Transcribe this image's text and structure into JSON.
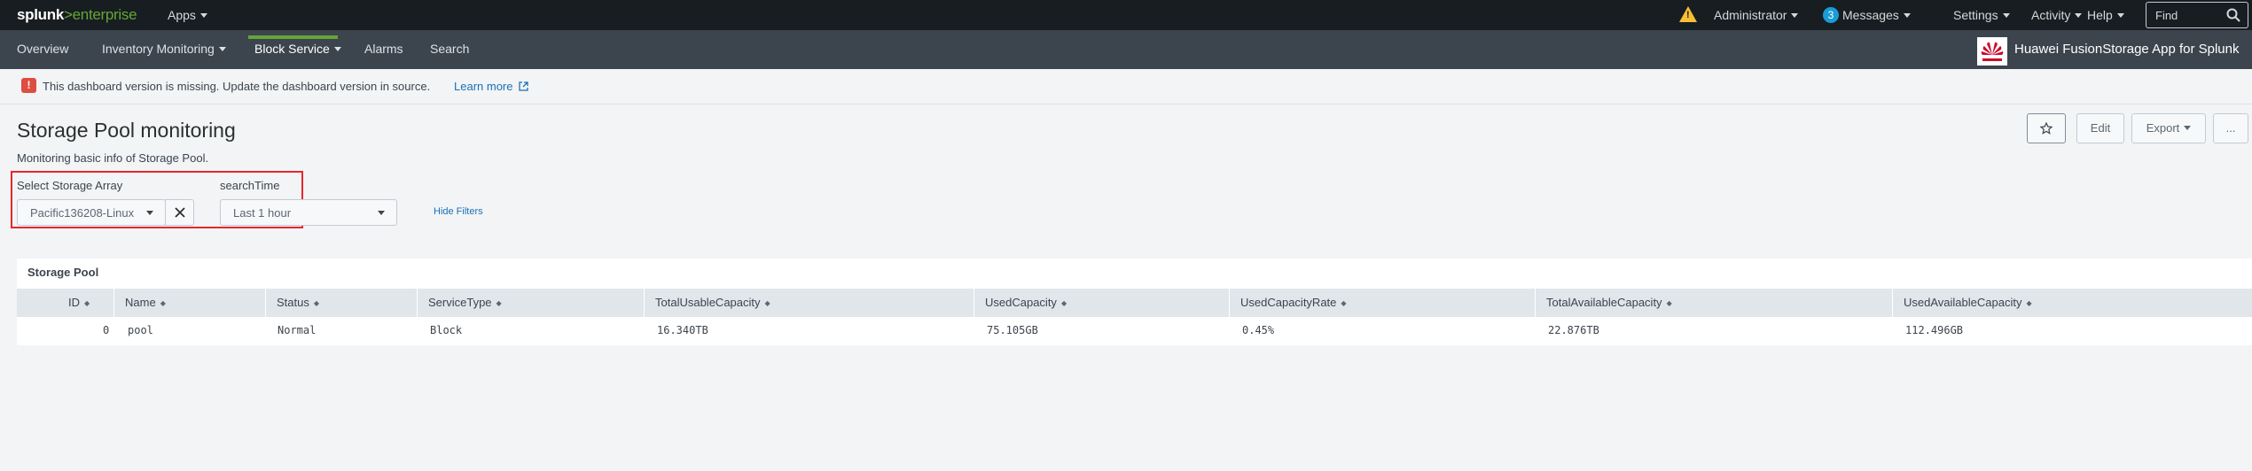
{
  "topbar": {
    "brand_splunk": "splunk",
    "brand_gt": ">",
    "brand_enterprise": "enterprise",
    "apps": "Apps",
    "administrator": "Administrator",
    "messages_count": "3",
    "messages": "Messages",
    "settings": "Settings",
    "activity": "Activity",
    "help": "Help",
    "find_placeholder": "Find"
  },
  "appbar": {
    "nav": [
      "Overview",
      "Inventory Monitoring",
      "Block Service",
      "Alarms",
      "Search"
    ],
    "active": "Block Service",
    "app_title": "Huawei FusionStorage App for Splunk"
  },
  "alert": {
    "text": "This dashboard version is missing. Update the dashboard version in source.",
    "link": "Learn more"
  },
  "header": {
    "title": "Storage Pool monitoring",
    "description": "Monitoring basic info of Storage Pool.",
    "edit": "Edit",
    "export": "Export",
    "more": "..."
  },
  "filters": {
    "storage_label": "Select Storage Array",
    "storage_value": "Pacific136208-Linux",
    "time_label": "searchTime",
    "time_value": "Last 1 hour",
    "hide_filters": "Hide Filters"
  },
  "panel": {
    "title": "Storage Pool",
    "columns": [
      "ID",
      "Name",
      "Status",
      "ServiceType",
      "TotalUsableCapacity",
      "UsedCapacity",
      "UsedCapacityRate",
      "TotalAvailableCapacity",
      "UsedAvailableCapacity"
    ],
    "rows": [
      [
        "0",
        "pool",
        "Normal",
        "Block",
        "16.340TB",
        "75.105GB",
        "0.45%",
        "22.876TB",
        "112.496GB"
      ]
    ]
  },
  "colors": {
    "topbar": "#171d21",
    "appbar": "#3c444d",
    "accent_green": "#65a637",
    "link_blue": "#1a70b8",
    "error_red": "#dc4e41",
    "highlight_red": "#e8262e"
  },
  "icons": [
    "warning-icon",
    "search-icon",
    "huawei-logo",
    "error-icon",
    "external-link-icon",
    "star-icon",
    "close-icon",
    "sort-icon"
  ]
}
